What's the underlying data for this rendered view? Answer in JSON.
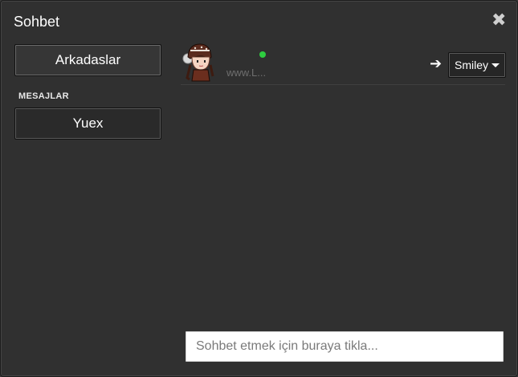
{
  "window": {
    "title": "Sohbet"
  },
  "sidebar": {
    "friends_button": "Arkadaslar",
    "messages_section_label": "MESAJLAR",
    "conversations": [
      {
        "label": "Yuex"
      }
    ]
  },
  "chat": {
    "contact_subtitle": "www.L...",
    "status": "online",
    "status_color": "#2ecc40",
    "send_icon": "arrow-right-icon",
    "smiley_button": "Smiley",
    "input_placeholder": "Sohbet etmek için buraya tikla..."
  },
  "icons": {
    "close": "close-icon",
    "avatar": "avatar-icon",
    "dropdown": "caret-down-icon"
  }
}
